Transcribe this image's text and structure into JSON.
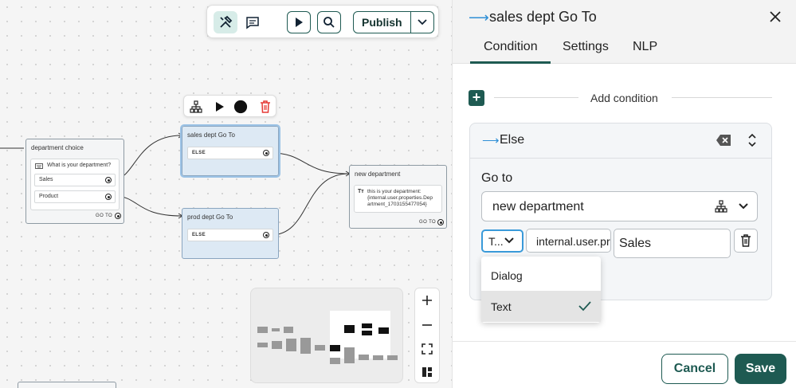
{
  "toolbar": {
    "publish_label": "Publish"
  },
  "canvas": {
    "nodes": {
      "department_choice": {
        "title": "department choice",
        "prompt": "What is your department?",
        "options": [
          "Sales",
          "Product"
        ],
        "goto": "GO TO"
      },
      "sales_goto": {
        "title": "sales dept Go To",
        "row": "ELSE"
      },
      "prod_goto": {
        "title": "prod dept Go To",
        "row": "ELSE"
      },
      "new_department": {
        "title": "new department",
        "text_line1": "this is your department:",
        "text_line2": "{internal.user.properties.Dep",
        "text_line3": "artment_1703155477054}",
        "goto": "GO TO"
      }
    }
  },
  "panel": {
    "title": "sales dept Go To",
    "tabs": [
      "Condition",
      "Settings",
      "NLP"
    ],
    "active_tab": "Condition",
    "add_condition_label": "Add condition",
    "condition": {
      "label": "Else",
      "goto_label": "Go to",
      "destination": "new department",
      "type_value": "T...",
      "variable_value": "internal.user.properties.Department",
      "value": "Sales",
      "type_options": [
        {
          "label": "Dialog",
          "selected": false
        },
        {
          "label": "Text",
          "selected": true
        }
      ]
    },
    "cancel_label": "Cancel",
    "save_label": "Save"
  },
  "colors": {
    "primary": "#1e5a52",
    "accent_blue": "#2f8fd6",
    "delete_red": "#e53935"
  }
}
